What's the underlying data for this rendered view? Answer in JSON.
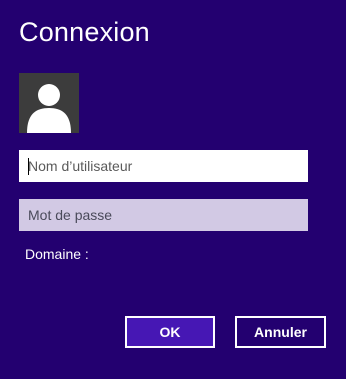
{
  "dialog": {
    "title": "Connexion",
    "username_placeholder": "Nom d’utilisateur",
    "username_value": "",
    "password_placeholder": "Mot de passe",
    "password_value": "",
    "domain_label": "Domaine :",
    "ok_label": "OK",
    "cancel_label": "Annuler",
    "avatar_icon": "user-silhouette-icon"
  },
  "colors": {
    "background": "#230070",
    "ok_button": "#4617b4",
    "password_field": "#d2c9e4",
    "avatar_bg": "#3c3c3c"
  }
}
